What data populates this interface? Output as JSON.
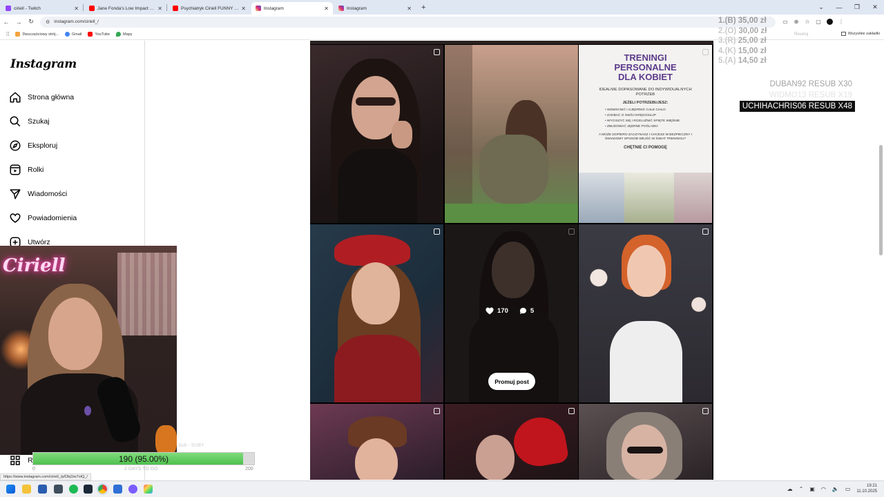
{
  "browser": {
    "tabs": [
      {
        "title": "ciriell - Twitch",
        "color": "#9146ff"
      },
      {
        "title": "Jane Fonda's Low Impact Workout",
        "color": "#ff0000"
      },
      {
        "title": "Psychiatryk Ciriell FUNNY MOMENTS",
        "color": "#ff0000"
      },
      {
        "title": "Instagram",
        "color": "#d62976"
      },
      {
        "title": "Instagram",
        "color": "#d62976"
      }
    ],
    "url": "instagram.com/ciriell_/",
    "bookmarks": [
      "Dwuczęściowy strój...",
      "Gmail",
      "YouTube",
      "Mapy"
    ],
    "all_bookmarks": "Wszystkie zakładki",
    "zoom_reset": "Resetuj"
  },
  "instagram": {
    "logo": "Instagram",
    "nav": [
      {
        "label": "Strona główna",
        "icon": "home-icon"
      },
      {
        "label": "Szukaj",
        "icon": "search-icon"
      },
      {
        "label": "Eksploruj",
        "icon": "compass-icon"
      },
      {
        "label": "Rolki",
        "icon": "reels-icon"
      },
      {
        "label": "Wiadomości",
        "icon": "send-icon"
      },
      {
        "label": "Powiadomienia",
        "icon": "heart-icon"
      },
      {
        "label": "Utwórz",
        "icon": "plus-icon"
      }
    ],
    "nav_more_partial": "R",
    "post_stats": {
      "likes": "170",
      "comments": "5"
    },
    "promote_button": "Promuj post",
    "poster": {
      "title_line1": "TRENINGI",
      "title_line2": "PERSONALNE",
      "title_line3": "DLA KOBIET",
      "subtitle": "IDEALNIE DOPASOWANE DO INDYWIDUALNYCH POTRZEB",
      "lead": "JEŻELI POTRZEBUJESZ:",
      "bullets": [
        "WZMOCNIĆ I UJĘDRNIĆ CAŁE CIAŁO",
        "ZADBAĆ O SWÓJ KRĘGOSŁUP",
        "WYCISZYĆ SIĘ I ROZLUŹNIĆ SPIĘTE MIĘŚNIE",
        "ZBUDOWAĆ JĘDRNE POŚLADKI"
      ],
      "note": "A MOŻE DOPIERO ZACZYNASZ I CHCESZ W BEZPIECZNY I ŚWIADOMY SPOSÓB WEJŚĆ W ŚWIAT TRENINGU?",
      "cta": "CHĘTNIE CI POMOGĘ"
    }
  },
  "overlay": {
    "prices": [
      {
        "rank": "1.(B)",
        "amount": "35,00 zł"
      },
      {
        "rank": "2.(O)",
        "amount": "30,00 zł"
      },
      {
        "rank": "3.(R)",
        "amount": "25,00 zł"
      },
      {
        "rank": "4.(K)",
        "amount": "15,00 zł"
      },
      {
        "rank": "5.(A)",
        "amount": "14,50 zł"
      }
    ],
    "resubs": [
      {
        "text": "DUBAN92  RESUB X30"
      },
      {
        "text": "WIDMO13  RESUB X19"
      },
      {
        "text": "UCHIHACHRIS06  RESUB X48"
      }
    ],
    "webcam_sign": "Ciriell",
    "goal": {
      "text": "190 (95.00%)",
      "progress": 0.95,
      "low": "0",
      "high": "200",
      "days": "2 DAYS TO GO",
      "faint": "Sub - SUBY"
    }
  },
  "status_url": "https://www.instagram.com/ciriell_/p/Dlq1lw7otQ_/",
  "clock": {
    "time": "19:21",
    "date": "11.10.2025"
  },
  "colors": {
    "ig_pink": "#d62976",
    "goal_green": "#4fbf4f",
    "neon": "#ff2fa6"
  }
}
